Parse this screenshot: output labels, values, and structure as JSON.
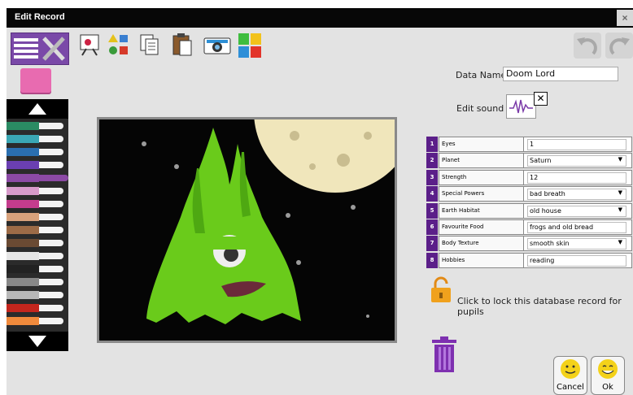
{
  "window": {
    "title": "Edit Record",
    "close_label": "×"
  },
  "toolbar": {
    "icons": [
      "pen-tools-icon",
      "edit-picture-icon",
      "shapes-icon",
      "copy-icon",
      "paste-icon",
      "camera-icon",
      "colour-squares-icon"
    ],
    "undo_icon": "undo-icon",
    "redo_icon": "redo-icon"
  },
  "palette": {
    "up_icon": "up-arrow-icon",
    "down_icon": "down-arrow-icon",
    "markers": [
      "#2a8b63",
      "#3aa7b4",
      "#2a6fb0",
      "#6a3fb1",
      "#8c4aa5",
      "#d89bcb",
      "#c43c8d",
      "#d8a27c",
      "#9c6b47",
      "#6a4a33",
      "#e6e6e6",
      "#222222",
      "#888888",
      "#b8b8b8",
      "#c4261d",
      "#f08a3c"
    ],
    "selected_index": 4
  },
  "form": {
    "data_name_label": "Data Name:",
    "data_name_value": "Doom Lord",
    "edit_sound_label": "Edit sound",
    "sound_remove": "✕",
    "fields": [
      {
        "n": "1",
        "name": "Eyes",
        "value": "1",
        "type": "text"
      },
      {
        "n": "2",
        "name": "Planet",
        "value": "Saturn",
        "type": "select"
      },
      {
        "n": "3",
        "name": "Strength",
        "value": "12",
        "type": "text"
      },
      {
        "n": "4",
        "name": "Special Powers",
        "value": "bad breath",
        "type": "select"
      },
      {
        "n": "5",
        "name": "Earth Habitat",
        "value": "old house",
        "type": "select"
      },
      {
        "n": "6",
        "name": "Favourite Food",
        "value": "frogs and old bread",
        "type": "text"
      },
      {
        "n": "7",
        "name": "Body Texture",
        "value": "smooth skin",
        "type": "select"
      },
      {
        "n": "8",
        "name": "Hobbies",
        "value": "reading",
        "type": "text"
      }
    ],
    "lock_text": "Click to lock this database record for pupils"
  },
  "buttons": {
    "cancel": "Cancel",
    "ok": "Ok"
  },
  "colors": {
    "accent": "#5b1f89",
    "titlebar": "#070707",
    "background": "#e3e3e3"
  }
}
